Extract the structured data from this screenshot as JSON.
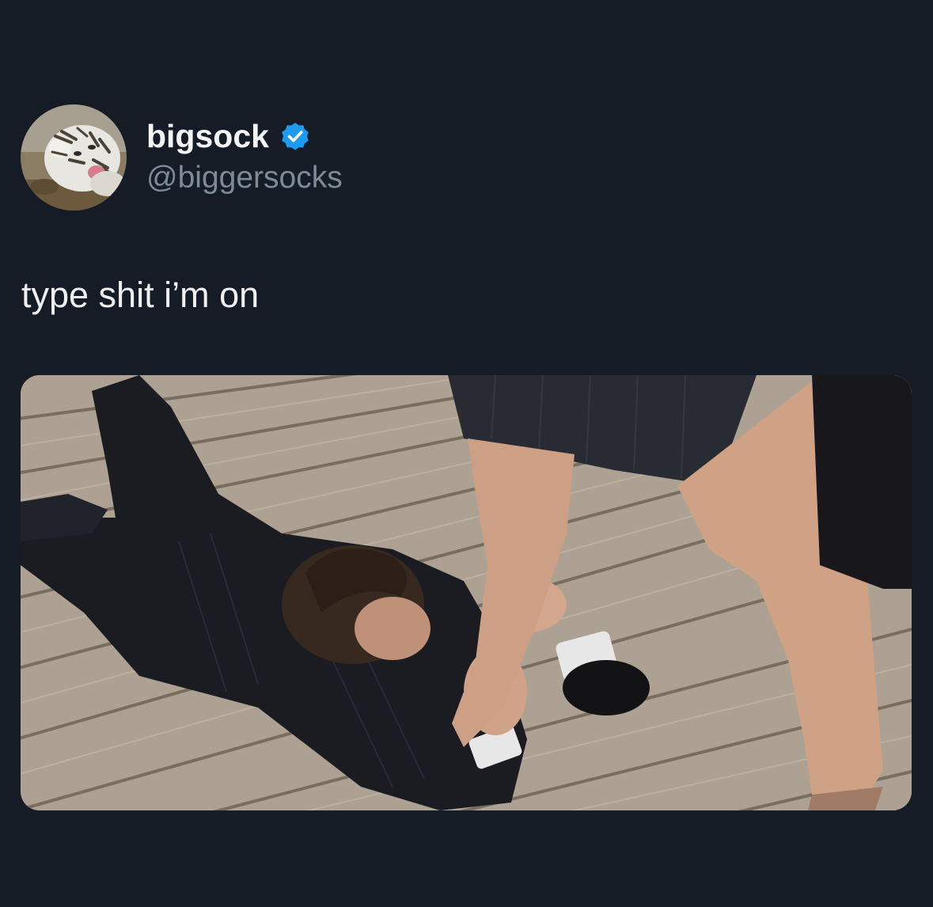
{
  "tweet": {
    "author": {
      "display_name": "bigsock",
      "handle": "@biggersocks",
      "verified": true,
      "verified_icon": "verified-badge-icon",
      "avatar_icon": "white-tiger-avatar"
    },
    "text": "type shit i’m on",
    "media": {
      "kind": "photo"
    }
  },
  "colors": {
    "background": "#151c26",
    "display_name": "#f3f4f6",
    "handle": "#7d8a97",
    "text": "#eef0f2",
    "verified": "#1d9bf0"
  }
}
